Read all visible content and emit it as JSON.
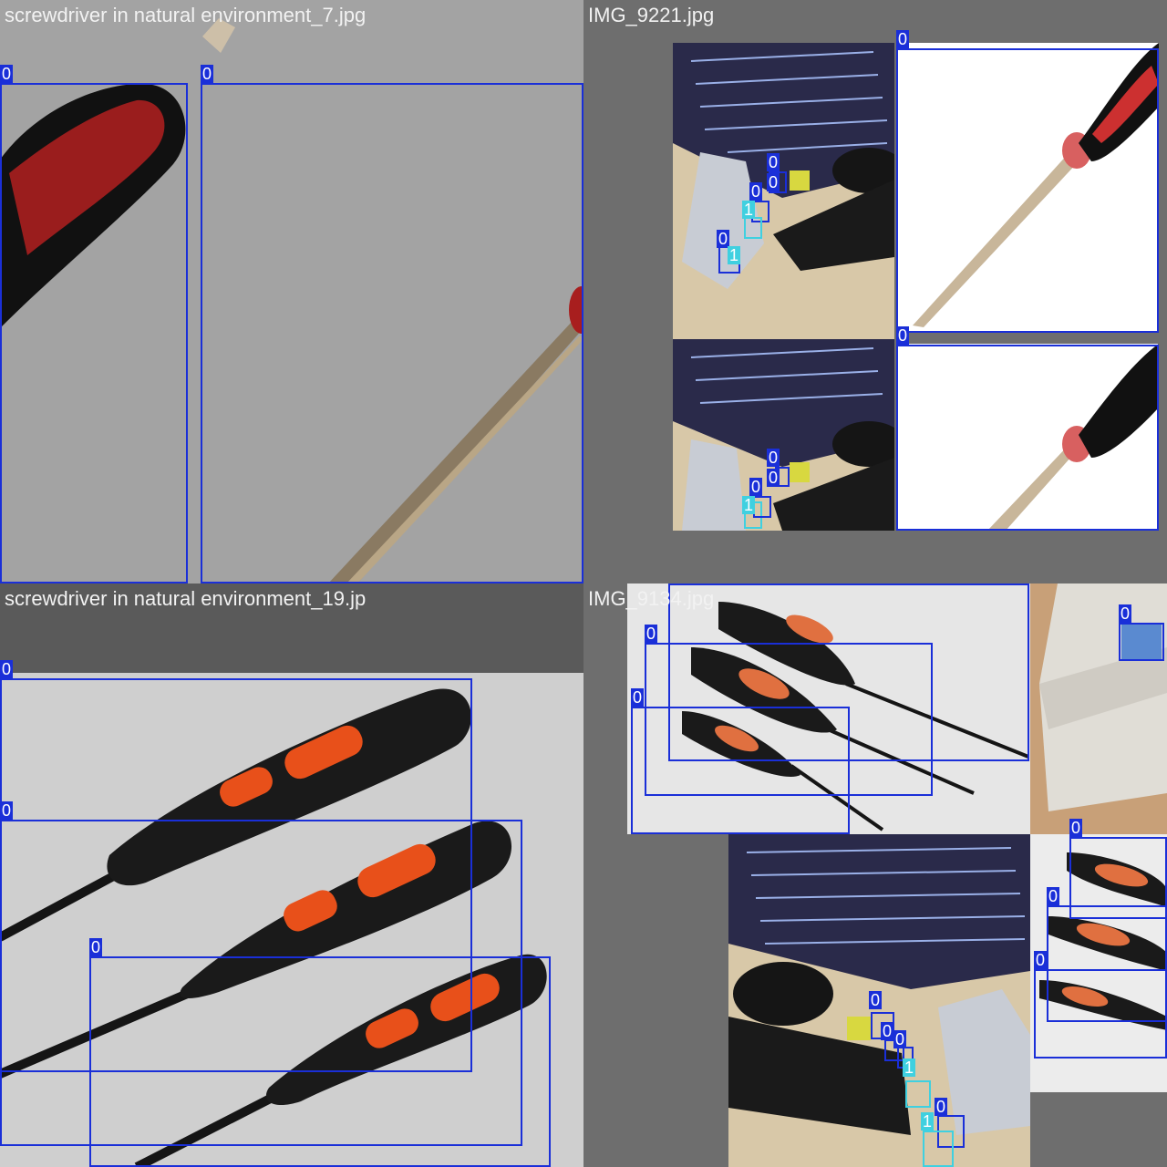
{
  "tiles": [
    {
      "title": "screwdriver in natural environment_7.jpg",
      "labels": [
        "0",
        "0"
      ]
    },
    {
      "title": "IMG_9221.jpg",
      "labels": [
        "0",
        "0",
        "0",
        "0",
        "0",
        "1",
        "0",
        "1",
        "0",
        "0",
        "0",
        "1"
      ]
    },
    {
      "title": "screwdriver in natural environment_19.jp",
      "labels": [
        "0",
        "0",
        "0"
      ]
    },
    {
      "title": "IMG_9134.jpg",
      "labels": [
        "0",
        "0",
        "0",
        "0",
        "0",
        "0",
        "0",
        "0",
        "0",
        "0",
        "1",
        "0",
        "1"
      ]
    }
  ],
  "colors": {
    "class0_box": "#1a2fd8",
    "class1_box": "#3fd0e0",
    "mosaic_gray": "#6e6e6e"
  }
}
